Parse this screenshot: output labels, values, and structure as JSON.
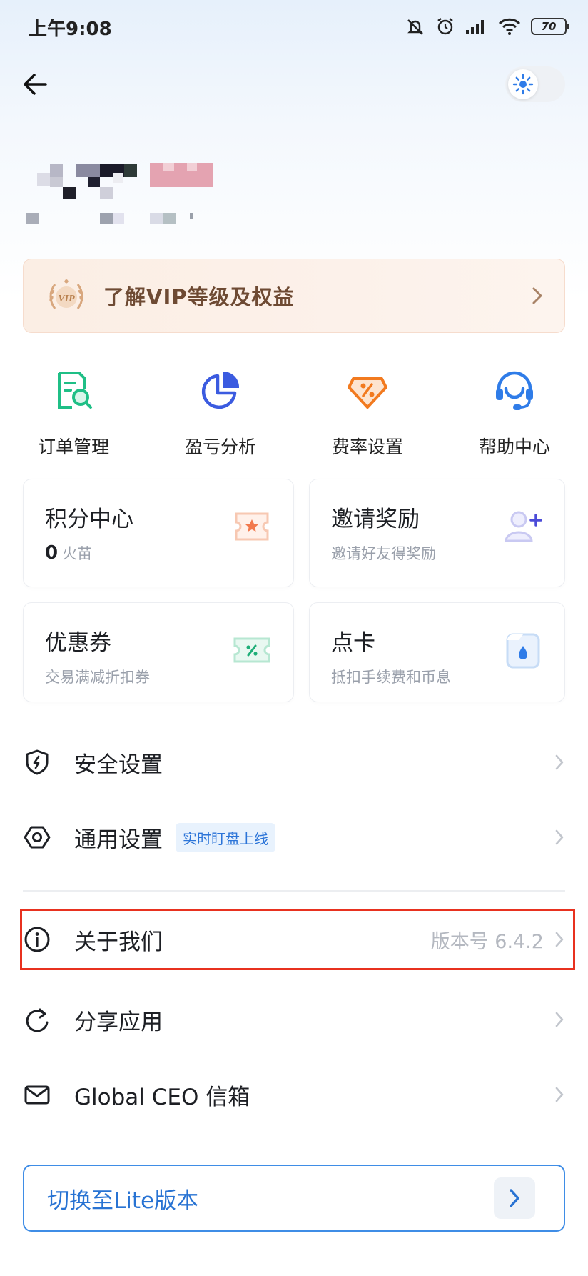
{
  "status_bar": {
    "time": "上午9:08",
    "battery": "70",
    "icons": [
      "mute-icon",
      "alarm-icon",
      "signal-icon",
      "wifi-icon",
      "battery-icon"
    ]
  },
  "header": {
    "back_icon": "arrow-left-icon",
    "theme_toggle_icon": "sun-icon"
  },
  "vip_banner": {
    "label": "了解VIP等级及权益",
    "badge_icon": "vip-laurel-icon"
  },
  "quick_actions": [
    {
      "label": "订单管理",
      "icon": "order-search-icon",
      "color": "#1fbf86"
    },
    {
      "label": "盈亏分析",
      "icon": "pie-chart-icon",
      "color": "#3b5be0"
    },
    {
      "label": "费率设置",
      "icon": "percent-tag-icon",
      "color": "#f27a1f"
    },
    {
      "label": "帮助中心",
      "icon": "headset-icon",
      "color": "#2f7ce8"
    }
  ],
  "cards": [
    {
      "title": "积分中心",
      "sub_number": "0",
      "sub_text": "火苗",
      "icon": "points-ticket-icon"
    },
    {
      "title": "邀请奖励",
      "sub_text": "邀请好友得奖励",
      "icon": "add-user-icon"
    },
    {
      "title": "优惠券",
      "sub_text": "交易满减折扣券",
      "icon": "coupon-icon"
    },
    {
      "title": "点卡",
      "sub_text": "抵扣手续费和币息",
      "icon": "point-card-icon"
    }
  ],
  "menu": [
    {
      "label": "安全设置",
      "icon": "shield-icon"
    },
    {
      "label": "通用设置",
      "icon": "hexagon-settings-icon",
      "tag": "实时盯盘上线"
    },
    {
      "label": "关于我们",
      "icon": "info-icon",
      "value": "版本号 6.4.2"
    },
    {
      "label": "分享应用",
      "icon": "share-refresh-icon"
    },
    {
      "label": "Global CEO 信箱",
      "icon": "mail-icon"
    }
  ],
  "lite_button": {
    "label": "切换至Lite版本"
  },
  "colors": {
    "accent_blue": "#2873d3",
    "highlight_red": "#e8311f",
    "vip_text": "#6e4a33"
  }
}
